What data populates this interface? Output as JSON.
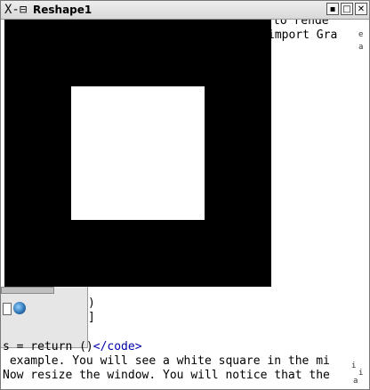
{
  "window": {
    "title": "Reshape1",
    "title_icon": "X-window-icon",
    "buttons": [
      "minimize-icon",
      "maximize-icon",
      "close-icon"
    ],
    "button_glyphs": [
      "▪",
      "□",
      "✕"
    ]
  },
  "background_text": {
    "line_a": "to rende",
    "line_b": "import Gra",
    "bracket_1": ")",
    "bracket_2": "]",
    "code_prefix": "s = return ()",
    "code_tag": "</code>",
    "sentence_1": " example. You will see a white square in the mi",
    "sentence_2": "Now resize the window. You will notice that the",
    "fragment_1": "e",
    "fragment_2": "a",
    "fragment_3": "i",
    "fragment_4": "i",
    "fragment_5": "a"
  },
  "gl_canvas": {
    "background": "#000000",
    "square_color": "#ffffff"
  },
  "colors": {
    "tag": "#0000aa",
    "titlebar": "#e4e4e4"
  }
}
